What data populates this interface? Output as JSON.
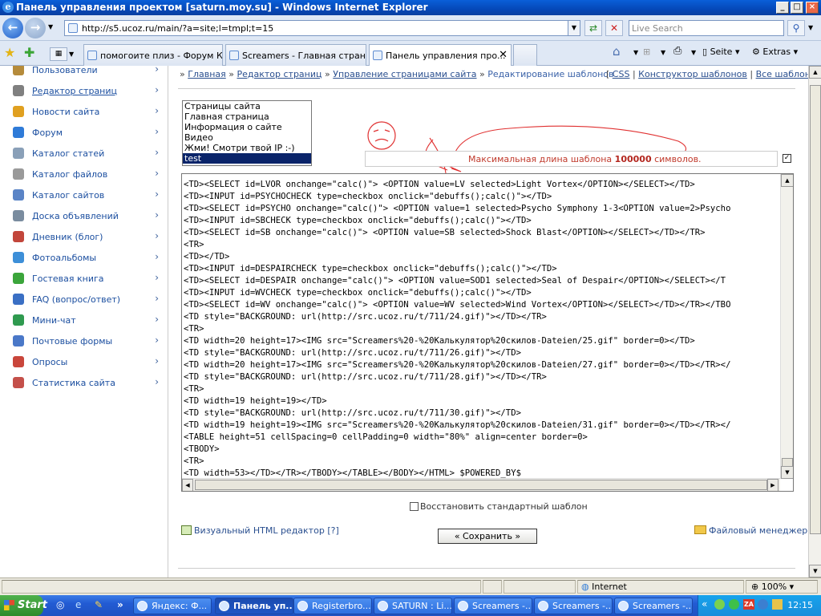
{
  "window": {
    "title": "Панель управления проектом [saturn.moy.su] - Windows Internet Explorer"
  },
  "address": {
    "url": "http://s5.ucoz.ru/main/?a=site;l=tmpl;t=15",
    "search_placeholder": "Live Search"
  },
  "tabs": [
    {
      "label": "помогоите плиз - Форум Кла..."
    },
    {
      "label": "Screamers - Главная стран..."
    },
    {
      "label": "Панель управления про..."
    }
  ],
  "toolbar": {
    "page_label": "Seite",
    "extras_label": "Extras"
  },
  "sidebar": {
    "items": [
      {
        "label": "Пользователи",
        "color": "#b58b3b"
      },
      {
        "label": "Редактор страниц",
        "color": "#808080"
      },
      {
        "label": "Новости сайта",
        "color": "#e0a020"
      },
      {
        "label": "Форум",
        "color": "#2f7bd8"
      },
      {
        "label": "Каталог статей",
        "color": "#8aa0b8"
      },
      {
        "label": "Каталог файлов",
        "color": "#9a9a9a"
      },
      {
        "label": "Каталог сайтов",
        "color": "#5a84c6"
      },
      {
        "label": "Доска объявлений",
        "color": "#7a8c9f"
      },
      {
        "label": "Дневник (блог)",
        "color": "#c2463b"
      },
      {
        "label": "Фотоальбомы",
        "color": "#3d8fd8"
      },
      {
        "label": "Гостевая книга",
        "color": "#3ba53b"
      },
      {
        "label": "FAQ (вопрос/ответ)",
        "color": "#3a6fc4"
      },
      {
        "label": "Мини-чат",
        "color": "#2f9a4f"
      },
      {
        "label": "Почтовые формы",
        "color": "#4a78c8"
      },
      {
        "label": "Опросы",
        "color": "#c9463b"
      },
      {
        "label": "Статистика сайта",
        "color": "#c4504a"
      }
    ]
  },
  "breadcrumb": {
    "items": [
      "Главная",
      "Редактор страниц",
      "Управление страницами сайта"
    ],
    "current": "Редактирование шаблонов"
  },
  "breadcrumb_links": {
    "css": "CSS",
    "builder": "Конструктор шаблонов",
    "all": "Все шаблоны"
  },
  "template_list": [
    "Страницы сайта",
    "Главная страница",
    "Информация о сайте",
    "Видео",
    "Жми! Смотри твой IP :-)",
    "test"
  ],
  "template_list_selected": "test",
  "maxlen": {
    "prefix": "Максимальная длина шаблона ",
    "value": "100000",
    "suffix": " символов."
  },
  "code_lines": [
    "<TD><SELECT id=LVOR onchange=\"calc()\"> <OPTION value=LV selected>Light Vortex</OPTION></SELECT></TD>",
    "<TD><INPUT id=PSYCHOCHECK type=checkbox onclick=\"debuffs();calc()\"></TD>",
    "<TD><SELECT id=PSYCHO onchange=\"calc()\"> <OPTION value=1 selected>Psycho Symphony 1-3<OPTION value=2>Psycho",
    "<TD><INPUT id=SBCHECK type=checkbox onclick=\"debuffs();calc()\"></TD>",
    "<TD><SELECT id=SB onchange=\"calc()\"> <OPTION value=SB selected>Shock Blast</OPTION></SELECT></TD></TR>",
    "<TR>",
    "<TD></TD>",
    "<TD><INPUT id=DESPAIRCHECK type=checkbox onclick=\"debuffs();calc()\"></TD>",
    "<TD><SELECT id=DESPAIR onchange=\"calc()\"> <OPTION value=SOD1 selected>Seal of Despair</OPTION></SELECT></T",
    "<TD><INPUT id=WVCHECK type=checkbox onclick=\"debuffs();calc()\"></TD>",
    "<TD><SELECT id=WV onchange=\"calc()\"> <OPTION value=WV selected>Wind Vortex</OPTION></SELECT></TD></TR></TBO",
    "<TD style=\"BACKGROUND: url(http://src.ucoz.ru/t/711/24.gif)\"></TD></TR>",
    "<TR>",
    "<TD width=20 height=17><IMG src=\"Screamers%20-%20Калькулятор%20скилов-Dateien/25.gif\" border=0></TD>",
    "<TD style=\"BACKGROUND: url(http://src.ucoz.ru/t/711/26.gif)\"></TD>",
    "<TD width=20 height=17><IMG src=\"Screamers%20-%20Калькулятор%20скилов-Dateien/27.gif\" border=0></TD></TR></",
    "<TD style=\"BACKGROUND: url(http://src.ucoz.ru/t/711/28.gif)\"></TD></TR>",
    "<TR>",
    "<TD width=19 height=19></TD>",
    "<TD style=\"BACKGROUND: url(http://src.ucoz.ru/t/711/30.gif)\"></TD>",
    "<TD width=19 height=19><IMG src=\"Screamers%20-%20Калькулятор%20скилов-Dateien/31.gif\" border=0></TD></TR></",
    "<TABLE height=51 cellSpacing=0 cellPadding=0 width=\"80%\" align=center border=0>",
    "<TBODY>",
    "<TR>",
    "<TD width=53></TD></TR></TBODY></TABLE></BODY></HTML> $POWERED_BY$"
  ],
  "restore_label": "Восстановить стандартный шаблон",
  "visual_editor": {
    "label": "Визуальный HTML редактор",
    "help": "[?]"
  },
  "save_label": "« Сохранить »",
  "file_manager_label": "Файловый менеджер",
  "status": {
    "zone": "Internet",
    "zoom": "100%"
  },
  "taskbar": {
    "start_label": "Start",
    "tasks": [
      {
        "label": "Яндекс: Ф..."
      },
      {
        "label": "Панель уп..."
      },
      {
        "label": "Registerbro..."
      },
      {
        "label": "SATURN : Li..."
      },
      {
        "label": "Screamers -..."
      },
      {
        "label": "Screamers -..."
      },
      {
        "label": "Screamers -..."
      }
    ],
    "clock": "12:15"
  }
}
